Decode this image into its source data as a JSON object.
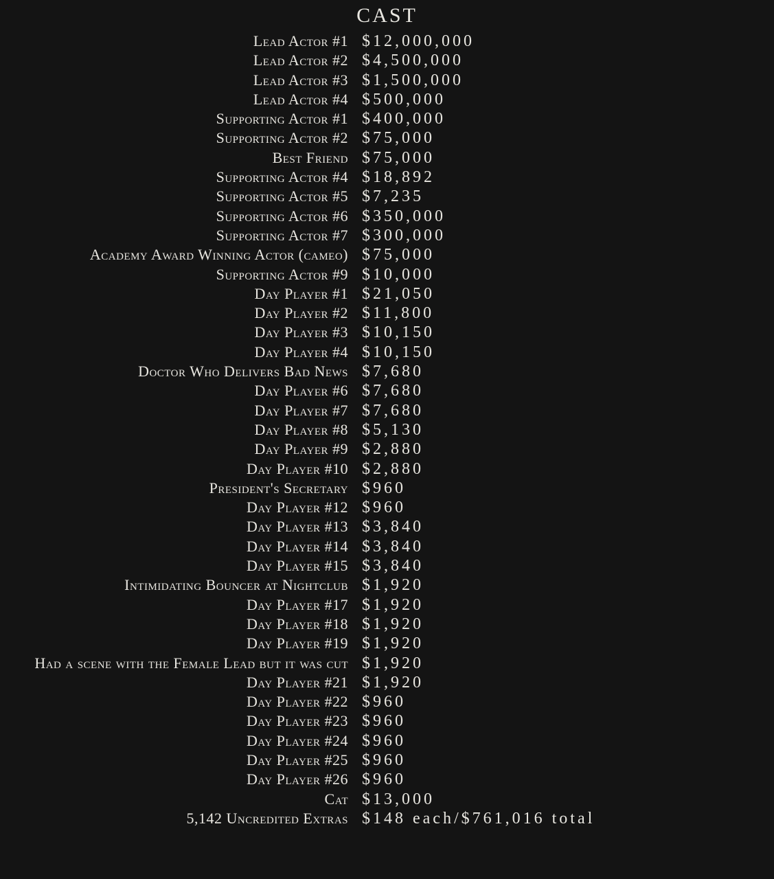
{
  "title": "CAST",
  "rows": [
    {
      "role": "Lead Actor #1",
      "amount": "$12,000,000"
    },
    {
      "role": "Lead Actor #2",
      "amount": "$4,500,000"
    },
    {
      "role": "Lead Actor #3",
      "amount": "$1,500,000"
    },
    {
      "role": "Lead Actor #4",
      "amount": "$500,000"
    },
    {
      "role": "Supporting Actor #1",
      "amount": "$400,000"
    },
    {
      "role": "Supporting Actor #2",
      "amount": "$75,000"
    },
    {
      "role": "Best Friend",
      "amount": "$75,000"
    },
    {
      "role": "Supporting Actor #4",
      "amount": "$18,892"
    },
    {
      "role": "Supporting Actor #5",
      "amount": "$7,235"
    },
    {
      "role": "Supporting Actor #6",
      "amount": "$350,000"
    },
    {
      "role": "Supporting Actor #7",
      "amount": "$300,000"
    },
    {
      "role": "Academy Award Winning Actor (cameo)",
      "amount": "$75,000"
    },
    {
      "role": "Supporting Actor #9",
      "amount": "$10,000"
    },
    {
      "role": "Day Player #1",
      "amount": "$21,050"
    },
    {
      "role": "Day Player #2",
      "amount": "$11,800"
    },
    {
      "role": "Day Player #3",
      "amount": "$10,150"
    },
    {
      "role": "Day Player #4",
      "amount": "$10,150"
    },
    {
      "role": "Doctor Who Delivers Bad News",
      "amount": "$7,680"
    },
    {
      "role": "Day Player #6",
      "amount": "$7,680"
    },
    {
      "role": "Day Player #7",
      "amount": "$7,680"
    },
    {
      "role": "Day Player #8",
      "amount": "$5,130"
    },
    {
      "role": "Day Player #9",
      "amount": "$2,880"
    },
    {
      "role": "Day Player #10",
      "amount": "$2,880"
    },
    {
      "role": "President's Secretary",
      "amount": "$960"
    },
    {
      "role": "Day Player #12",
      "amount": "$960"
    },
    {
      "role": "Day Player #13",
      "amount": "$3,840"
    },
    {
      "role": "Day Player #14",
      "amount": "$3,840"
    },
    {
      "role": "Day Player #15",
      "amount": "$3,840"
    },
    {
      "role": "Intimidating Bouncer at Nightclub",
      "amount": "$1,920"
    },
    {
      "role": "Day Player #17",
      "amount": "$1,920"
    },
    {
      "role": "Day Player #18",
      "amount": "$1,920"
    },
    {
      "role": "Day Player #19",
      "amount": "$1,920"
    },
    {
      "role": "Had a scene with the Female Lead but it was cut",
      "amount": "$1,920"
    },
    {
      "role": "Day Player #21",
      "amount": "$1,920"
    },
    {
      "role": "Day Player #22",
      "amount": "$960"
    },
    {
      "role": "Day Player #23",
      "amount": "$960"
    },
    {
      "role": "Day Player #24",
      "amount": "$960"
    },
    {
      "role": "Day Player #25",
      "amount": "$960"
    },
    {
      "role": "Day Player #26",
      "amount": "$960"
    },
    {
      "role": "Cat",
      "amount": "$13,000"
    },
    {
      "role": "5,142 Uncredited Extras",
      "amount": "$148 each/$761,016 total"
    }
  ]
}
